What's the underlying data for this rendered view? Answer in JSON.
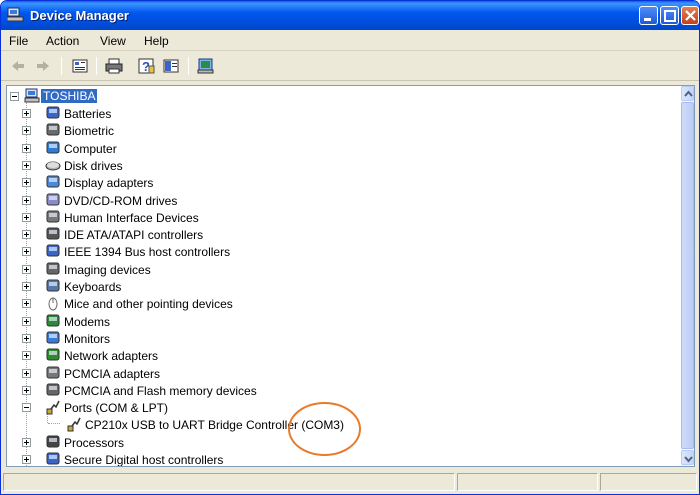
{
  "window": {
    "title": "Device Manager"
  },
  "menu": [
    "File",
    "Action",
    "View",
    "Help"
  ],
  "toolbar": [
    "back-icon",
    "forward-icon",
    "properties-icon",
    "print-icon",
    "help-icon",
    "show-hide-icon",
    "update-driver-icon"
  ],
  "tree": {
    "root": "TOSHIBA",
    "items": [
      {
        "label": "Batteries",
        "icon": "battery-icon"
      },
      {
        "label": "Biometric",
        "icon": "biometric-icon"
      },
      {
        "label": "Computer",
        "icon": "computer-icon"
      },
      {
        "label": "Disk drives",
        "icon": "disk-drive-icon"
      },
      {
        "label": "Display adapters",
        "icon": "display-adapter-icon"
      },
      {
        "label": "DVD/CD-ROM drives",
        "icon": "dvd-drive-icon"
      },
      {
        "label": "Human Interface Devices",
        "icon": "hid-icon"
      },
      {
        "label": "IDE ATA/ATAPI controllers",
        "icon": "ide-controller-icon"
      },
      {
        "label": "IEEE 1394 Bus host controllers",
        "icon": "ieee1394-icon"
      },
      {
        "label": "Imaging devices",
        "icon": "imaging-icon"
      },
      {
        "label": "Keyboards",
        "icon": "keyboard-icon"
      },
      {
        "label": "Mice and other pointing devices",
        "icon": "mouse-icon"
      },
      {
        "label": "Modems",
        "icon": "modem-icon"
      },
      {
        "label": "Monitors",
        "icon": "monitor-icon"
      },
      {
        "label": "Network adapters",
        "icon": "network-adapter-icon"
      },
      {
        "label": "PCMCIA adapters",
        "icon": "pcmcia-icon"
      },
      {
        "label": "PCMCIA and Flash memory devices",
        "icon": "flash-memory-icon"
      },
      {
        "label": "Ports (COM & LPT)",
        "icon": "port-icon",
        "expanded": true
      },
      {
        "label": "CP210x USB to UART Bridge Controller (COM3)",
        "icon": "port-device-icon",
        "child": true
      },
      {
        "label": "Processors",
        "icon": "processor-icon"
      },
      {
        "label": "Secure Digital host controllers",
        "icon": "sd-host-icon"
      }
    ]
  },
  "colors": {
    "selection": "#316ac5",
    "highlight_circle": "#e97a2b",
    "titlebar": "#0058ee"
  }
}
